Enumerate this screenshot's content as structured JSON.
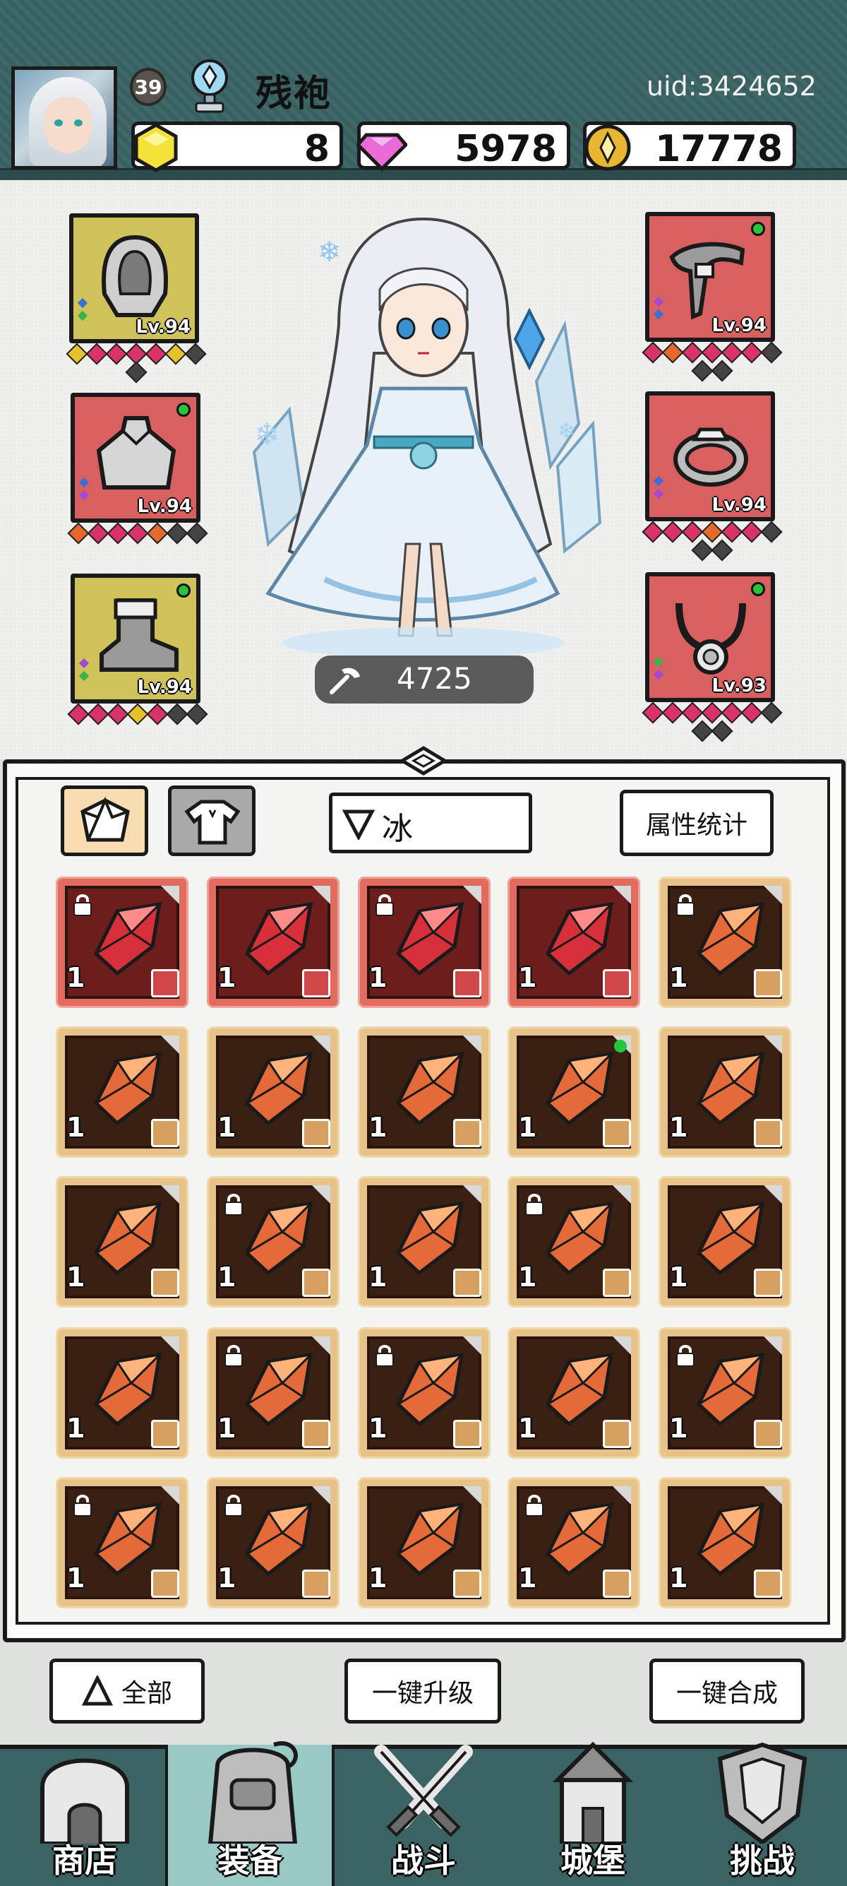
{
  "header": {
    "level": "39",
    "player_name": "残袍",
    "uid": "uid:3424652",
    "resources": [
      {
        "name": "yellow-gem",
        "value": "8"
      },
      {
        "name": "pink-diamond",
        "value": "5978"
      },
      {
        "name": "gold-coin",
        "value": "17778"
      }
    ]
  },
  "equipment": {
    "left": [
      {
        "slot": "helmet",
        "level": "Lv.94",
        "color": "yellow",
        "indicator": false
      },
      {
        "slot": "cloak",
        "level": "Lv.94",
        "color": "red",
        "indicator": true
      },
      {
        "slot": "boots",
        "level": "Lv.94",
        "color": "yellow",
        "indicator": true
      }
    ],
    "right": [
      {
        "slot": "weapon",
        "level": "Lv.94",
        "color": "red",
        "indicator": true
      },
      {
        "slot": "ring",
        "level": "Lv.94",
        "color": "red",
        "indicator": false
      },
      {
        "slot": "necklace",
        "level": "Lv.93",
        "color": "red",
        "indicator": true
      }
    ]
  },
  "character": {
    "power": "4725"
  },
  "bag": {
    "filter_label": "冰",
    "attr_button": "属性统计"
  },
  "actions": {
    "all": "全部",
    "upgrade": "一键升级",
    "merge": "一键合成"
  },
  "nav": [
    {
      "label": "商店",
      "icon": "shop-icon"
    },
    {
      "label": "装备",
      "icon": "backpack-icon"
    },
    {
      "label": "战斗",
      "icon": "crossed-swords-icon"
    },
    {
      "label": "城堡",
      "icon": "castle-icon"
    },
    {
      "label": "挑战",
      "icon": "shield-icon"
    }
  ],
  "colors": {
    "header_bg": "#3b6363",
    "active_tab": "#98c9c4",
    "red_frame": "#e26b5f",
    "gold_frame": "#e8c389"
  }
}
